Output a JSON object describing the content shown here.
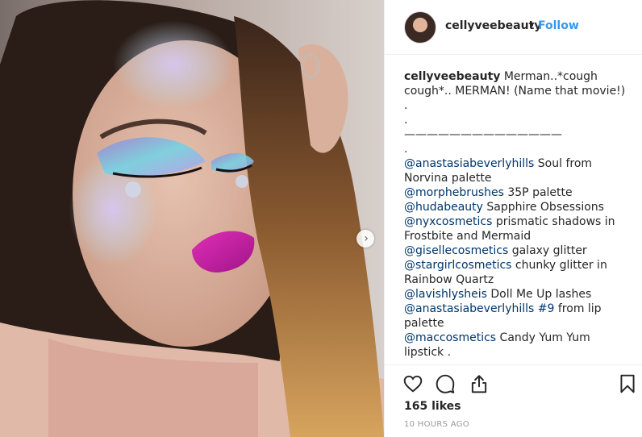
{
  "post": {
    "username": "cellyveebeauty",
    "follow_label": "Follow",
    "caption": {
      "username": "cellyveebeauty",
      "lines": [
        [
          {
            "t": "cellyveebeauty",
            "type": "user"
          },
          {
            "t": " Merman..*cough",
            "type": "text"
          }
        ],
        [
          {
            "t": "cough*.. MERMAN! (Name that movie!)",
            "type": "text"
          }
        ],
        [
          {
            "t": ".",
            "type": "text"
          }
        ],
        [
          {
            "t": ".",
            "type": "text"
          }
        ],
        [
          {
            "t": "——————————————",
            "type": "text"
          }
        ],
        [
          {
            "t": ".",
            "type": "text"
          }
        ],
        [
          {
            "t": "@anastasiabeverlyhills",
            "type": "mention"
          },
          {
            "t": " Soul from",
            "type": "text"
          }
        ],
        [
          {
            "t": "Norvina palette",
            "type": "text"
          }
        ],
        [
          {
            "t": "@morphebrushes",
            "type": "mention"
          },
          {
            "t": " 35P palette",
            "type": "text"
          }
        ],
        [
          {
            "t": "@hudabeauty",
            "type": "mention"
          },
          {
            "t": " Sapphire Obsessions",
            "type": "text"
          }
        ],
        [
          {
            "t": "@nyxcosmetics",
            "type": "mention"
          },
          {
            "t": " prismatic shadows in",
            "type": "text"
          }
        ],
        [
          {
            "t": "Frostbite and Mermaid",
            "type": "text"
          }
        ],
        [
          {
            "t": "@gisellecosmetics",
            "type": "mention"
          },
          {
            "t": " galaxy glitter",
            "type": "text"
          }
        ],
        [
          {
            "t": "@stargirlcosmetics",
            "type": "mention"
          },
          {
            "t": " chunky glitter in",
            "type": "text"
          }
        ],
        [
          {
            "t": "Rainbow Quartz",
            "type": "text"
          }
        ],
        [
          {
            "t": "@lavishlysheis",
            "type": "mention"
          },
          {
            "t": " Doll Me Up lashes",
            "type": "text"
          }
        ],
        [
          {
            "t": "@anastasiabeverlyhills",
            "type": "mention"
          },
          {
            "t": " ",
            "type": "text"
          },
          {
            "t": "#9",
            "type": "mention"
          },
          {
            "t": " from lip",
            "type": "text"
          }
        ],
        [
          {
            "t": "palette",
            "type": "text"
          }
        ],
        [
          {
            "t": "@maccosmetics",
            "type": "mention"
          },
          {
            "t": " Candy Yum Yum",
            "type": "text"
          }
        ],
        [
          {
            "t": "lipstick .",
            "type": "text"
          }
        ]
      ]
    },
    "likes": "165 likes",
    "timestamp": "10 HOURS AGO"
  },
  "icons": {
    "like": "heart-icon",
    "comment": "comment-icon",
    "share": "share-icon",
    "save": "bookmark-icon",
    "next": "chevron-right-icon"
  },
  "colors": {
    "link": "#003569",
    "follow": "#3897f0",
    "text": "#262626",
    "muted": "#999999"
  }
}
